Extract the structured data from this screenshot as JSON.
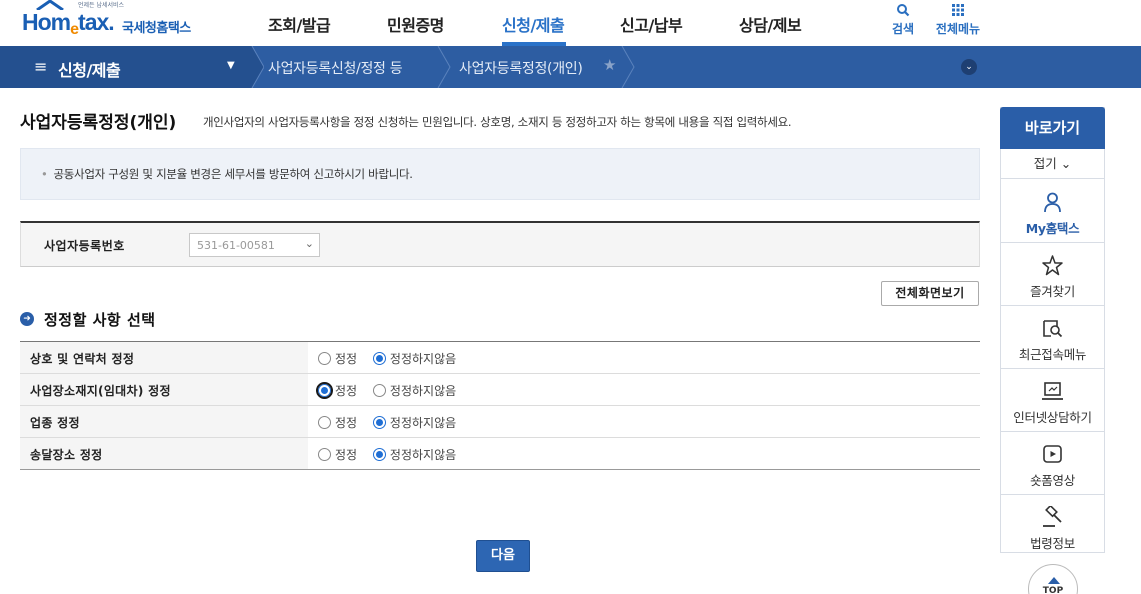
{
  "logo": {
    "tagline": "언제든 납세서비스",
    "brand": "Hom",
    "brand_e": "e",
    "brand_tail": "tax.",
    "sub": "국세청홈택스"
  },
  "gnb": {
    "items": [
      {
        "label": "조회/발급"
      },
      {
        "label": "민원증명"
      },
      {
        "label": "신청/제출"
      },
      {
        "label": "신고/납부"
      },
      {
        "label": "상담/제보"
      }
    ],
    "active_index": 2
  },
  "top_tools": {
    "search": "검색",
    "all_menu": "전체메뉴"
  },
  "location": {
    "menu_icon": "≡",
    "menu_label": "신청/제출",
    "crumbs": [
      "사업자등록신청/정정 등",
      "사업자등록정정(개인)"
    ],
    "star": "★"
  },
  "page": {
    "title": "사업자등록정정(개인)",
    "description": "개인사업자의 사업자등록사항을 정정 신청하는 민원입니다. 상호명, 소재지 등 정정하고자 하는 항목에 내용을 직접 입력하세요."
  },
  "notice": {
    "bullet": "•",
    "text": "공동사업자 구성원 및 지분율 변경은 세무서를 방문하여 신고하시기 바랍니다."
  },
  "business": {
    "label": "사업자등록번호",
    "number": "531-61-00581"
  },
  "buttons": {
    "full_screen": "전체화면보기",
    "next": "다음"
  },
  "section": {
    "icon": "➜",
    "title": "정정할 사항 선택"
  },
  "options": {
    "choice_yes": "정정",
    "choice_no": "정정하지않음",
    "rows": [
      {
        "label": "상호 및 연락처 정정",
        "selected": "no"
      },
      {
        "label": "사업장소재지(임대차) 정정",
        "selected": "yes"
      },
      {
        "label": "업종 정정",
        "selected": "no"
      },
      {
        "label": "송달장소 정정",
        "selected": "no"
      }
    ]
  },
  "quick_menu": {
    "title": "바로가기",
    "fold": "접기 ⌄",
    "items": [
      {
        "label": "My홈택스",
        "icon": "person-icon"
      },
      {
        "label": "즐겨찾기",
        "icon": "star-icon"
      },
      {
        "label": "최근접속메뉴",
        "icon": "recent-search-icon"
      },
      {
        "label": "인터넷상담하기",
        "icon": "monitor-icon"
      },
      {
        "label": "숏폼영상",
        "icon": "play-icon"
      },
      {
        "label": "법령정보",
        "icon": "gavel-icon"
      }
    ],
    "top": "TOP"
  },
  "colors": {
    "brand_blue": "#2a5ea8",
    "locbar": "#2d5da2",
    "accent_orange": "#f08a00",
    "radio_blue": "#1f6ed4"
  }
}
